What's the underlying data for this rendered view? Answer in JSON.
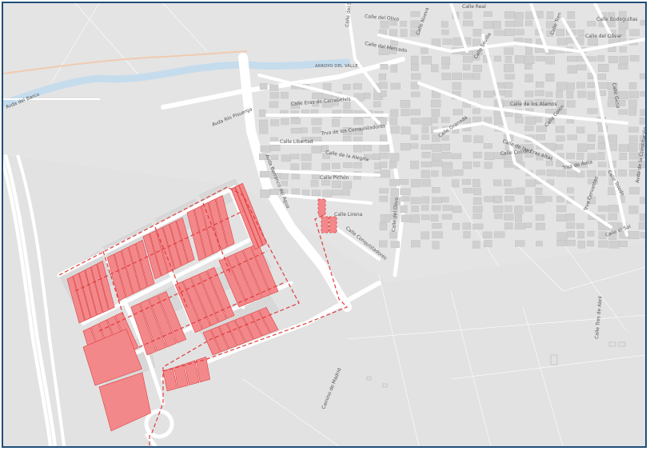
{
  "map": {
    "colors": {
      "background": "#e4e4e4",
      "street": "#ffffff",
      "block": "#d0d0d0",
      "river": "#c5dced",
      "track": "#f0cbb1",
      "highlight_fill": "#f3888b",
      "highlight_outline": "#e03c3c",
      "frame": "#1f4e79"
    },
    "street_labels": [
      "Avda del Barco",
      "Avda Río Pisuerga",
      "ARROYO DEL VALLE",
      "Calle del Mercado",
      "Calle Eras de Carrabelvis",
      "Trva de los Conquistadores",
      "Calle Libertad",
      "Calle de la Alegría",
      "Calle Pichón",
      "Calle Lirena",
      "Calle Conquistadores",
      "Calle del Olivo",
      "Avda Barranco del Agua",
      "Calle del Olivo",
      "Calle Real",
      "Calle Bodeguillas",
      "Calle del Olivar",
      "Avda de la Constitución",
      "Calle de los Alamos",
      "Calle Granada",
      "Calle Colón",
      "Calle de las Eras Altas",
      "Calle Coliseo",
      "Trva de Ávila",
      "Trva Cervantes",
      "Calle Toledo",
      "Calle el Sol",
      "Calle Tres de Abril",
      "Calle Gosa",
      "Camino de Madrid",
      "Calle Sevilla",
      "Calle Tren",
      "Calle Nueva",
      "Calle del Sol"
    ]
  }
}
